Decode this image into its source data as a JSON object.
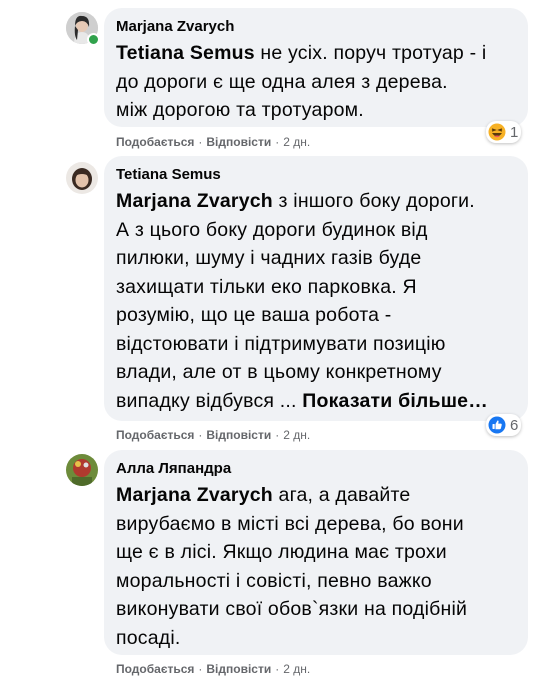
{
  "comments": [
    {
      "author": "Marjana Zvarych",
      "mention": "Tetiana Semus",
      "text_lines": [
        " не усіх. поруч тротуар - і",
        "до дороги є ще одна алея з дерева.",
        "між дорогою та тротуаром."
      ],
      "like_label": "Подобається",
      "reply_label": "Відповісти",
      "time": "2 дн.",
      "reaction_icon": "haha-emoji-icon",
      "reaction_count": "1"
    },
    {
      "author": "Tetiana Semus",
      "mention": "Marjana Zvarych",
      "text_lines": [
        " з іншого боку дороги.",
        "А з цього боку дороги будинок від",
        "пилюки, шуму і чадних газів буде",
        "захищати тільки еко парковка. Я",
        "розумію, що це ваша робота -",
        "відстоювати і підтримувати позицію",
        "влади, але от в цьому конкретному",
        "випадку відбувся ... "
      ],
      "see_more": "Показати більше…",
      "like_label": "Подобається",
      "reply_label": "Відповісти",
      "time": "2 дн.",
      "reaction_icon": "like-thumb-icon",
      "reaction_count": "6"
    },
    {
      "author": "Алла Ляпандра",
      "mention": "Marjana Zvarych",
      "text_lines": [
        " ага, а давайте",
        "вирубаємо в місті всі дерева, бо вони",
        "ще є в лісі. Якщо людина має трохи",
        "моральності і совісті, певно важко",
        "виконувати свої обов`язки на подібній",
        "посаді."
      ],
      "like_label": "Подобається",
      "reply_label": "Відповісти",
      "time": "2 дн."
    }
  ],
  "colors": {
    "bubble": "#f0f2f5",
    "meta": "#65676b",
    "online": "#31a24c",
    "like_blue": "#1877f2"
  }
}
